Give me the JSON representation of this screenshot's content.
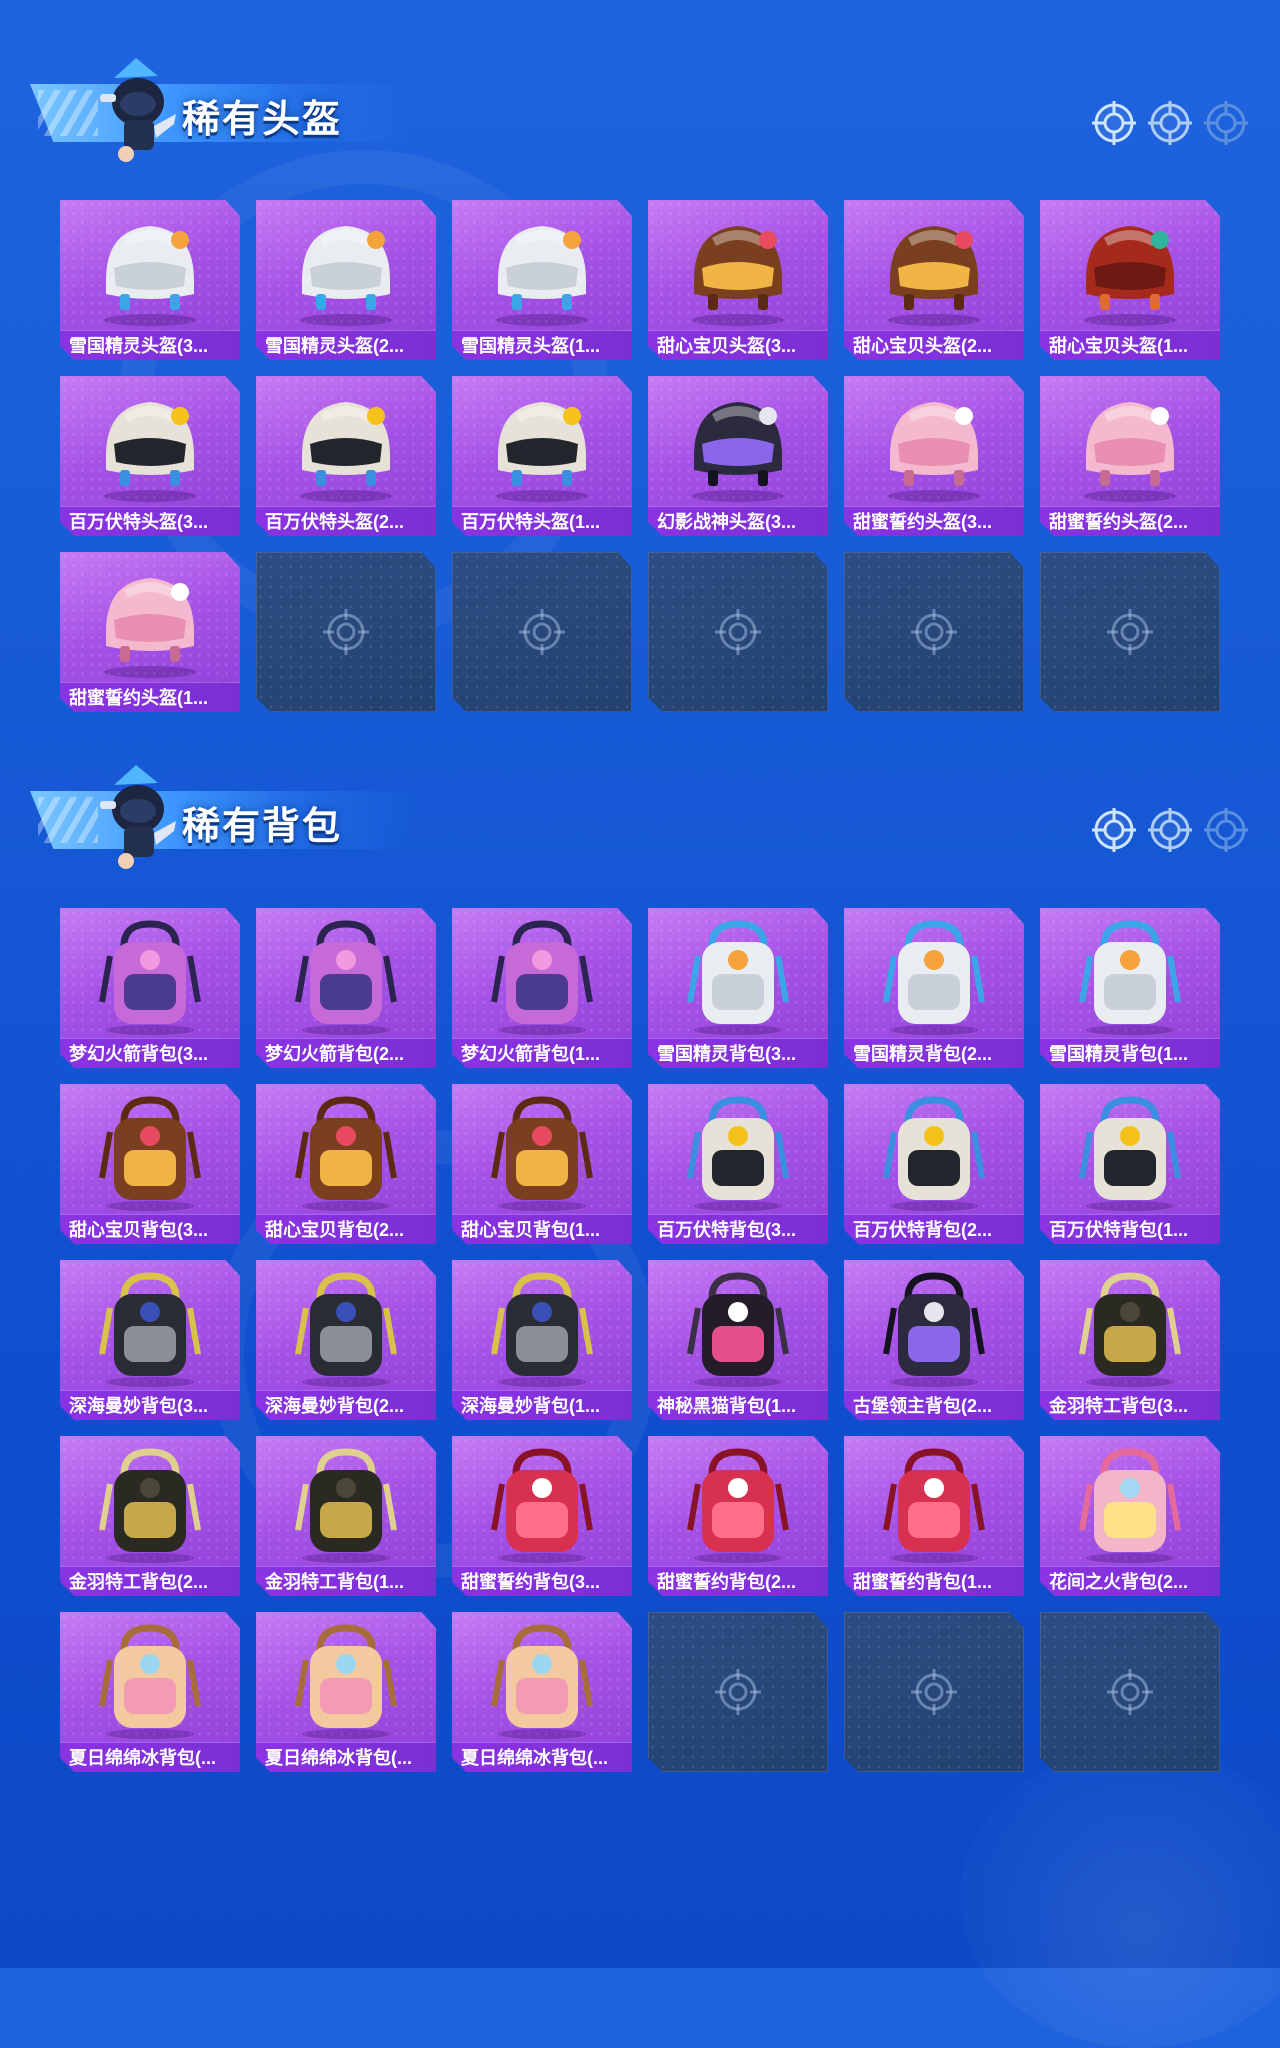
{
  "colors": {
    "background": "#1a5bd8",
    "card_purple": "#a552e6",
    "label_purple": "#7a2fd3",
    "empty_slot": "#2a4877"
  },
  "sections": [
    {
      "title": "稀有头盔",
      "items": [
        {
          "label": "雪国精灵头盔(3...",
          "kind": "helmet",
          "theme": "snow"
        },
        {
          "label": "雪国精灵头盔(2...",
          "kind": "helmet",
          "theme": "snow"
        },
        {
          "label": "雪国精灵头盔(1...",
          "kind": "helmet",
          "theme": "snow"
        },
        {
          "label": "甜心宝贝头盔(3...",
          "kind": "helmet",
          "theme": "sweet"
        },
        {
          "label": "甜心宝贝头盔(2...",
          "kind": "helmet",
          "theme": "sweet"
        },
        {
          "label": "甜心宝贝头盔(1...",
          "kind": "helmet",
          "theme": "red"
        },
        {
          "label": "百万伏特头盔(3...",
          "kind": "helmet",
          "theme": "volt"
        },
        {
          "label": "百万伏特头盔(2...",
          "kind": "helmet",
          "theme": "volt"
        },
        {
          "label": "百万伏特头盔(1...",
          "kind": "helmet",
          "theme": "volt"
        },
        {
          "label": "幻影战神头盔(3...",
          "kind": "helmet",
          "theme": "phantom"
        },
        {
          "label": "甜蜜誓约头盔(3...",
          "kind": "helmet",
          "theme": "pink"
        },
        {
          "label": "甜蜜誓约头盔(2...",
          "kind": "helmet",
          "theme": "pink"
        },
        {
          "label": "甜蜜誓约头盔(1...",
          "kind": "helmet",
          "theme": "pink"
        }
      ],
      "empty_slots": 5
    },
    {
      "title": "稀有背包",
      "items": [
        {
          "label": "梦幻火箭背包(3...",
          "kind": "backpack",
          "theme": "rocket"
        },
        {
          "label": "梦幻火箭背包(2...",
          "kind": "backpack",
          "theme": "rocket"
        },
        {
          "label": "梦幻火箭背包(1...",
          "kind": "backpack",
          "theme": "rocket"
        },
        {
          "label": "雪国精灵背包(3...",
          "kind": "backpack",
          "theme": "snow"
        },
        {
          "label": "雪国精灵背包(2...",
          "kind": "backpack",
          "theme": "snow"
        },
        {
          "label": "雪国精灵背包(1...",
          "kind": "backpack",
          "theme": "snow"
        },
        {
          "label": "甜心宝贝背包(3...",
          "kind": "backpack",
          "theme": "sweet"
        },
        {
          "label": "甜心宝贝背包(2...",
          "kind": "backpack",
          "theme": "sweet"
        },
        {
          "label": "甜心宝贝背包(1...",
          "kind": "backpack",
          "theme": "sweet"
        },
        {
          "label": "百万伏特背包(3...",
          "kind": "backpack",
          "theme": "volt"
        },
        {
          "label": "百万伏特背包(2...",
          "kind": "backpack",
          "theme": "volt"
        },
        {
          "label": "百万伏特背包(1...",
          "kind": "backpack",
          "theme": "volt"
        },
        {
          "label": "深海曼妙背包(3...",
          "kind": "backpack",
          "theme": "deepsea"
        },
        {
          "label": "深海曼妙背包(2...",
          "kind": "backpack",
          "theme": "deepsea"
        },
        {
          "label": "深海曼妙背包(1...",
          "kind": "backpack",
          "theme": "deepsea"
        },
        {
          "label": "神秘黑猫背包(1...",
          "kind": "backpack",
          "theme": "cat"
        },
        {
          "label": "古堡领主背包(2...",
          "kind": "backpack",
          "theme": "phantom"
        },
        {
          "label": "金羽特工背包(3...",
          "kind": "backpack",
          "theme": "gold"
        },
        {
          "label": "金羽特工背包(2...",
          "kind": "backpack",
          "theme": "gold"
        },
        {
          "label": "金羽特工背包(1...",
          "kind": "backpack",
          "theme": "gold"
        },
        {
          "label": "甜蜜誓约背包(3...",
          "kind": "backpack",
          "theme": "pinkheart"
        },
        {
          "label": "甜蜜誓约背包(2...",
          "kind": "backpack",
          "theme": "pinkheart"
        },
        {
          "label": "甜蜜誓约背包(1...",
          "kind": "backpack",
          "theme": "pinkheart"
        },
        {
          "label": "花间之火背包(2...",
          "kind": "backpack",
          "theme": "flower"
        },
        {
          "label": "夏日绵绵冰背包(...",
          "kind": "backpack",
          "theme": "icecream"
        },
        {
          "label": "夏日绵绵冰背包(...",
          "kind": "backpack",
          "theme": "icecream"
        },
        {
          "label": "夏日绵绵冰背包(...",
          "kind": "backpack",
          "theme": "icecream"
        }
      ],
      "empty_slots": 3
    }
  ],
  "header_icons": [
    "crosshair-icon",
    "crosshair-icon",
    "crosshair-icon"
  ]
}
